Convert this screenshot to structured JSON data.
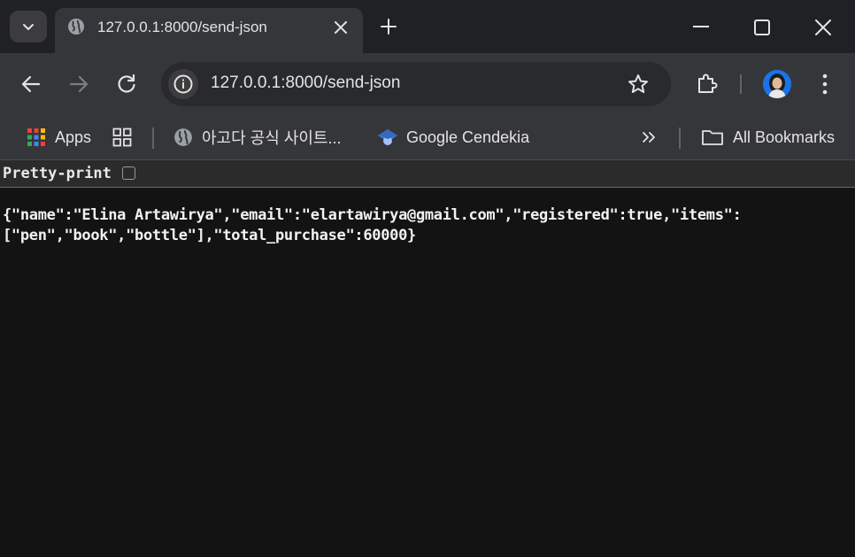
{
  "tab": {
    "title": "127.0.0.1:8000/send-json"
  },
  "omnibox": {
    "url": "127.0.0.1:8000/send-json"
  },
  "bookmarks": {
    "apps": "Apps",
    "agoda": "아고다 공식 사이트...",
    "scholar": "Google Cendekia",
    "all": "All Bookmarks"
  },
  "page": {
    "pretty_print_label": "Pretty-print",
    "json_text": "{\"name\":\"Elina Artawirya\",\"email\":\"elartawirya@gmail.com\",\"registered\":true,\"items\":\n[\"pen\",\"book\",\"bottle\"],\"total_purchase\":60000}"
  },
  "icons": {
    "tab_search": "chevron-down-icon",
    "favicon": "globe-icon",
    "close_tab": "close-icon",
    "new_tab": "plus-icon",
    "back": "arrow-left-icon",
    "forward": "arrow-right-icon",
    "reload": "reload-icon",
    "site_info": "info-icon",
    "bookmark": "star-icon",
    "extensions": "puzzle-icon",
    "menu": "kebab-menu-icon",
    "overflow": "double-chevron-icon",
    "folder": "folder-icon"
  },
  "colors": {
    "frame": "#202124",
    "toolbar": "#35363a",
    "page_bg": "#131314",
    "text": "#e3e3e3"
  }
}
